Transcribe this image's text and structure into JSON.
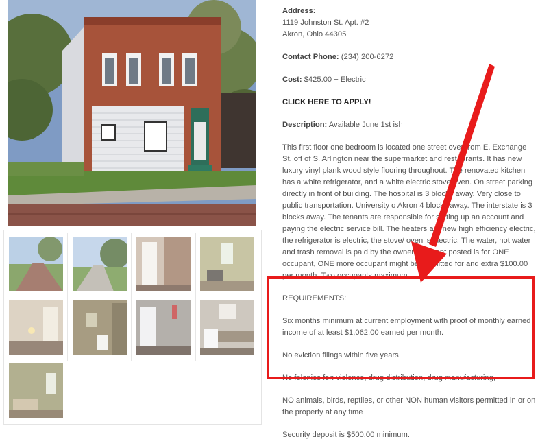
{
  "address": {
    "label": "Address:",
    "line1": "1119 Johnston St. Apt. #2",
    "line2": "Akron, Ohio 44305"
  },
  "contact": {
    "label": "Contact Phone:",
    "value": " (234) 200-6272"
  },
  "cost": {
    "label": "Cost:",
    "value": " $425.00 + Electric"
  },
  "apply": {
    "label": "CLICK HERE TO APPLY!"
  },
  "description": {
    "label": "Description:",
    "value": "  Available June 1st ish",
    "body": "This first floor one bedroom is located one street over from E. Exchange St. off of S. Arlington near the supermarket and restaurants. It has new luxury vinyl plank wood style flooring throughout. The renovated kitchen has a white refrigerator, and a white electric stove/oven. On street parking directly in front of building.  The hospital is 3 blocks away. Very close to public transportation. University o Akron 4 blocks away. The interstate is 3 blocks away. The tenants are responsible for setting up an account and paying the electric service bill. The heaters are new high efficiency electric, the refrigerator is electric, the stove/ oven is electric. The water,  hot water and trash removal is paid by the owner. The rent posted is for ONE occupant, ONE more occupant might be permitted for and extra $100.00 per month. Two occupants maximum."
  },
  "requirements": {
    "heading": "REQUIREMENTS:",
    "items": [
      "Six months minimum at current employment with proof of monthly earned income of at least $1,062.00 earned per month.",
      "No eviction filings within five years",
      "No felonies for: violence, drug distribution, drug manufacturing,"
    ]
  },
  "extra": [
    "NO animals, birds, reptiles, or other NON human visitors permitted in or on the property at any time",
    "Security deposit is $500.00 minimum."
  ],
  "colors": {
    "highlight": "#e81b1b",
    "text": "#555555",
    "label": "#444444"
  },
  "gallery": {
    "thumbnails": [
      "street-view-1",
      "street-view-2",
      "entry-door",
      "living-room",
      "bedroom-lamp",
      "bathroom",
      "kitchen-door",
      "kitchen-stove",
      "bedroom-window"
    ]
  }
}
